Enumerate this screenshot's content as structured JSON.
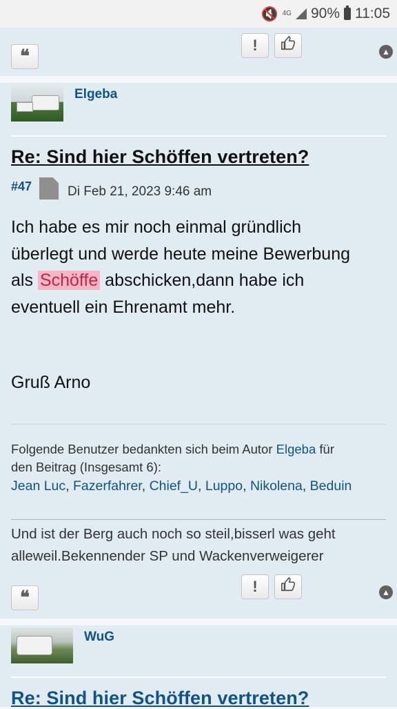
{
  "status_bar": {
    "network": "4G",
    "battery": "90%",
    "time": "11:05"
  },
  "post_prev": {
    "report_icon": "!",
    "like_icon": "thumbs-up"
  },
  "post": {
    "author": "Elgeba",
    "title": "Re: Sind hier Schöffen vertreten?",
    "number": "#47",
    "date": "Di Feb 21, 2023 9:46 am",
    "content": {
      "line1": "Ich habe es mir noch einmal gründlich",
      "line2": "überlegt und werde heute meine Bewerbung",
      "line3_before": "als ",
      "line3_highlight": "Schöffe",
      "line3_after": " abschicken,dann habe ich",
      "line4": "eventuell ein Ehrenamt mehr."
    },
    "greeting": "Gruß Arno",
    "thanks": {
      "prefix": "Folgende Benutzer bedankten sich beim Autor ",
      "author": "Elgeba",
      "suffix_1": " für",
      "line2": "den Beitrag (Insgesamt 6):",
      "users": [
        "Jean Luc",
        "Fazerfahrer",
        "Chief_U",
        "Luppo",
        "Nikolena",
        "Beduin"
      ]
    },
    "signature": {
      "line1": "Und ist der Berg auch noch so steil,bisserl was geht",
      "line2": "alleweil.Bekennender SP und Wackenverweigerer"
    }
  },
  "post_next": {
    "author": "WuG",
    "title": "Re: Sind hier Schöffen vertreten?"
  },
  "colors": {
    "post_bg": "#e1ebf2",
    "link": "#105289",
    "highlight_bg": "#f5b7c4",
    "highlight_text": "#c22449"
  }
}
